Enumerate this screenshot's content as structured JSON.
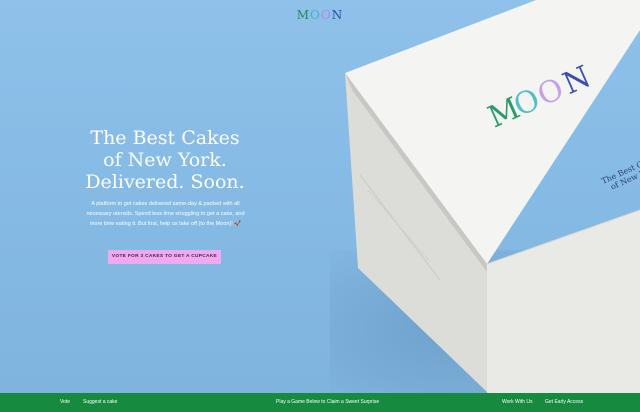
{
  "brand": {
    "logo_letters": [
      "M",
      "O",
      "O",
      "N"
    ],
    "colors": {
      "green": "#1f8a5a",
      "teal": "#3db4c8",
      "lilac": "#b38be0",
      "navy": "#2c4aa8"
    }
  },
  "hero": {
    "headline_lines": [
      "The Best Cakes",
      "of New York.",
      "Delivered. Soon."
    ],
    "description": "A platform to get cakes delivered same-day & packed with all necessary utensils. Spend less time struggling to get a cake, and more time eating it. But first, help us take off (to the Moon)! 🚀",
    "cta_label": "VOTE FOR 3 CAKES TO GET A CUPCAKE",
    "background_color": "#86bbe5",
    "cta_color": "#f0a8ee"
  },
  "box": {
    "logo_letters": [
      "M",
      "O",
      "O",
      "N"
    ],
    "tagline_lines": [
      "The Best C",
      "of New Y"
    ]
  },
  "footer": {
    "vote": "Vote",
    "suggest": "Suggest a cake",
    "play": "Play a Game Below to Claim a Sweet Surprise",
    "work": "Work With Us",
    "early": "Get Early Access",
    "background_color": "#168a3e"
  }
}
